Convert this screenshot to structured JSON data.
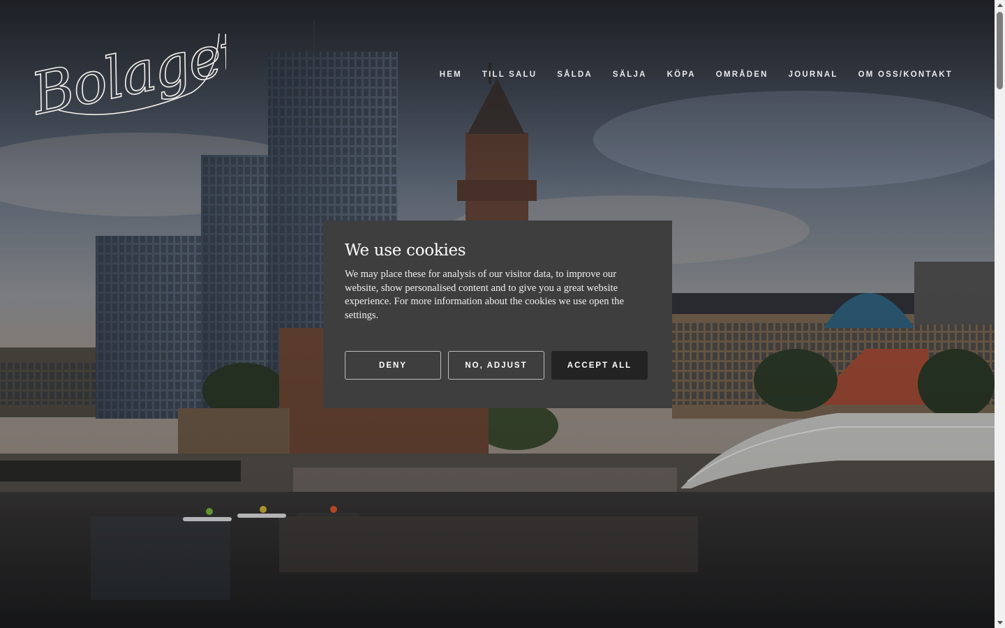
{
  "brand": {
    "logo_text": "Bolaget"
  },
  "nav": {
    "items": [
      {
        "label": "HEM"
      },
      {
        "label": "TILL SALU"
      },
      {
        "label": "SÅLDA"
      },
      {
        "label": "SÄLJA"
      },
      {
        "label": "KÖPA"
      },
      {
        "label": "OMRÅDEN"
      },
      {
        "label": "JOURNAL"
      },
      {
        "label": "OM OSS/KONTAKT"
      }
    ]
  },
  "cookie_banner": {
    "title": "We use cookies",
    "body": "We may place these for analysis of our visitor data, to improve our website, show personalised content and to give you a great website experience. For more information about the cookies we use open the settings.",
    "deny_label": "DENY",
    "adjust_label": "NO, ADJUST",
    "accept_label": "ACCEPT ALL"
  },
  "colors": {
    "dialog_background": "#3e3e3f",
    "accept_button": "#232323",
    "nav_text": "#e8e9ec"
  },
  "icons": {
    "scroll_up": "triangle-up",
    "scroll_down": "triangle-down"
  }
}
